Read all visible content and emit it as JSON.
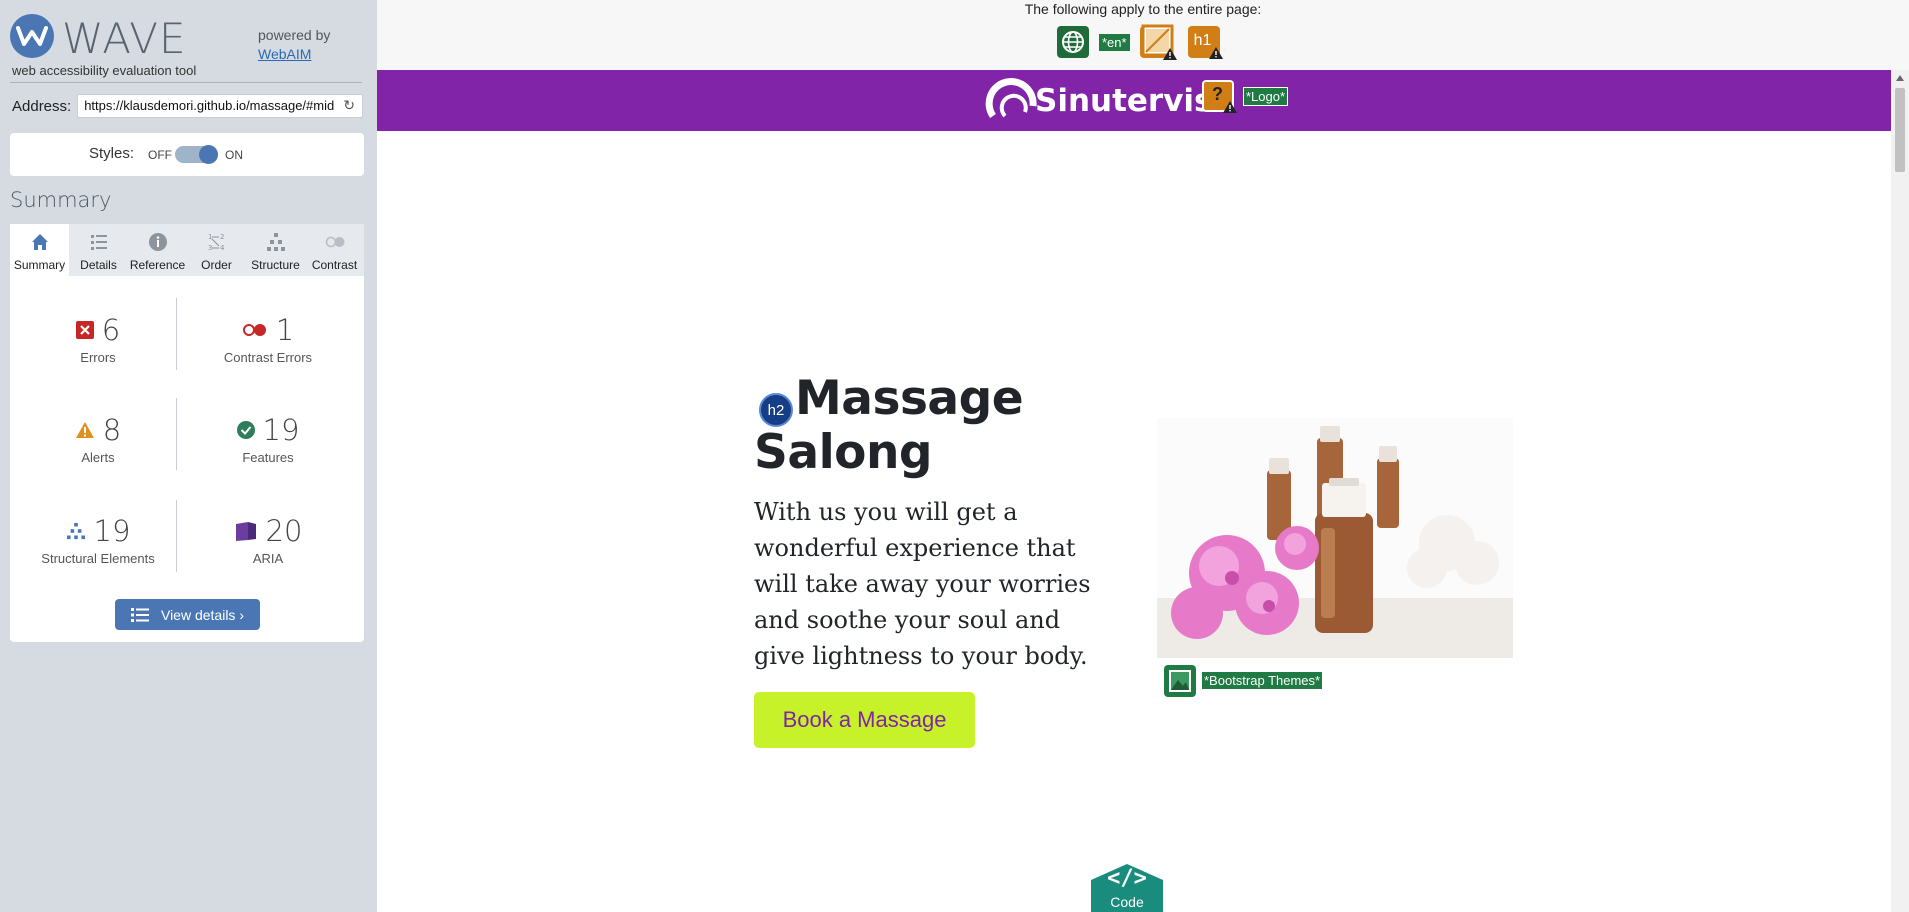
{
  "sidebar": {
    "brand": "WAVE",
    "tagline": "web accessibility evaluation tool",
    "powered_by": "powered by",
    "webaim": "WebAIM",
    "address_label": "Address:",
    "address_value": "https://klausdemori.github.io/massage/#mid",
    "styles_label": "Styles:",
    "styles_off": "OFF",
    "styles_on": "ON",
    "summary_title": "Summary",
    "tabs": [
      {
        "label": "Summary",
        "icon": "home-icon"
      },
      {
        "label": "Details",
        "icon": "list-icon"
      },
      {
        "label": "Reference",
        "icon": "info-icon"
      },
      {
        "label": "Order",
        "icon": "order-icon"
      },
      {
        "label": "Structure",
        "icon": "structure-icon"
      },
      {
        "label": "Contrast",
        "icon": "contrast-icon"
      }
    ],
    "stats": [
      {
        "value": "6",
        "label": "Errors",
        "icon": "error-icon"
      },
      {
        "value": "1",
        "label": "Contrast Errors",
        "icon": "contrast-error-icon"
      },
      {
        "value": "8",
        "label": "Alerts",
        "icon": "alert-icon"
      },
      {
        "value": "19",
        "label": "Features",
        "icon": "feature-icon"
      },
      {
        "value": "19",
        "label": "Structural Elements",
        "icon": "structure-icon"
      },
      {
        "value": "20",
        "label": "ARIA",
        "icon": "aria-icon"
      }
    ],
    "view_details": "View details ›"
  },
  "page": {
    "applies_text": "The following apply to the entire page:",
    "lang_tag": "*en*",
    "h1_icon": "h1",
    "site_name": "Sinutervis",
    "logo_tag": "*Logo*",
    "h2_badge": "h2",
    "headline": "Massage Salong",
    "lead": "With us you will get a wonderful experience that will take away your worries and soothe your soul and give lightness to your body.",
    "cta": "Book a Massage",
    "img_tag": "*Bootstrap Themes*",
    "code_label": "Code",
    "code_glyph": "</>"
  },
  "colors": {
    "accent": "#4a77b4",
    "brand_purple": "#8124a8",
    "cta_green": "#c7f22a",
    "feature_green": "#1f7a43"
  }
}
